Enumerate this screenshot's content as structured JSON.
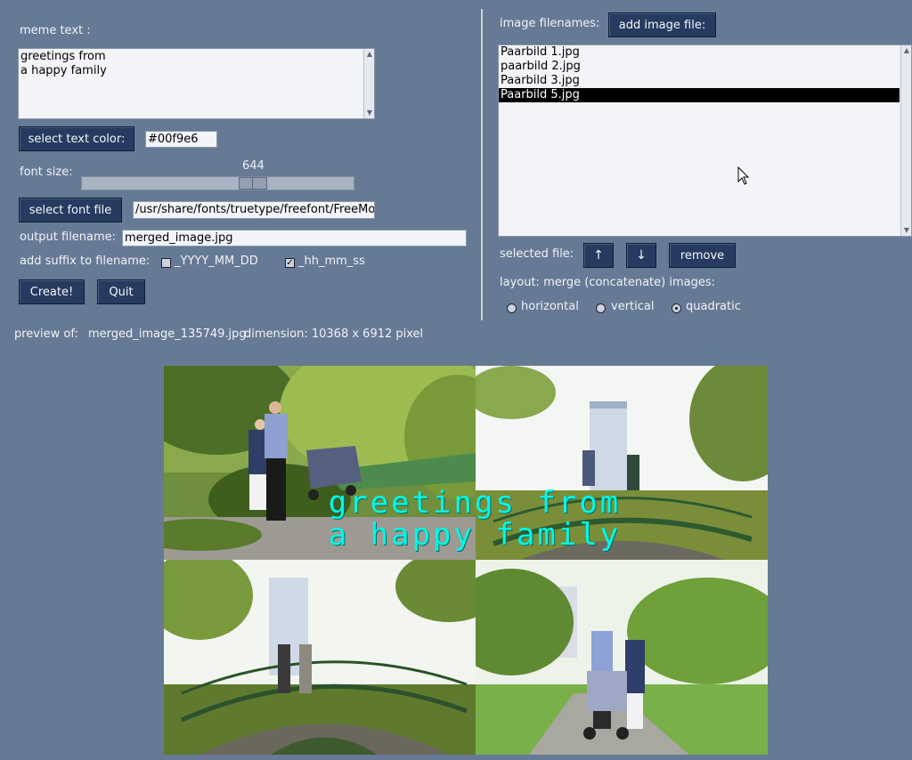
{
  "left": {
    "meme_text_label": "meme text :",
    "meme_text_line1": "greetings from",
    "meme_text_line2": "a happy family",
    "select_text_color_button": "select text color:",
    "text_color_value": "#00f9e6",
    "font_size_label": "font size:",
    "font_size_value": "644",
    "select_font_button": "select font file",
    "font_file_value": "/usr/share/fonts/truetype/freefont/FreeMono",
    "output_filename_label": "output filename:",
    "output_filename_value": "merged_image.jpg",
    "suffix_label": "add suffix to filename:",
    "suffix_date_label": "_YYYY_MM_DD",
    "suffix_date_checked": false,
    "suffix_time_label": "_hh_mm_ss",
    "suffix_time_checked": true,
    "create_button": "Create!",
    "quit_button": "Quit"
  },
  "right": {
    "image_filenames_label": "image filenames:",
    "add_image_button": "add image file:",
    "files": [
      "Paarbild 1.jpg",
      "paarbild 2.jpg",
      "Paarbild 3.jpg",
      "Paarbild 5.jpg"
    ],
    "selected_index": 3,
    "selected_file_label": "selected file:",
    "move_up_button": "↑",
    "move_down_button": "↓",
    "remove_button": "remove",
    "layout_label": "layout: merge (concatenate) images:",
    "layout_options": [
      "horizontal",
      "vertical",
      "quadratic"
    ],
    "layout_selected": "quadratic"
  },
  "preview": {
    "label": "preview of:",
    "filename": "merged_image_135749.jpg",
    "dimension": "dimension: 10368 x 6912 pixel",
    "overlay_line1": "greetings from",
    "overlay_line2": "a happy family",
    "overlay_color": "#00f9e6"
  },
  "colors": {
    "background": "#667a95",
    "button": "#263b5f",
    "field": "#f2f4f8"
  }
}
